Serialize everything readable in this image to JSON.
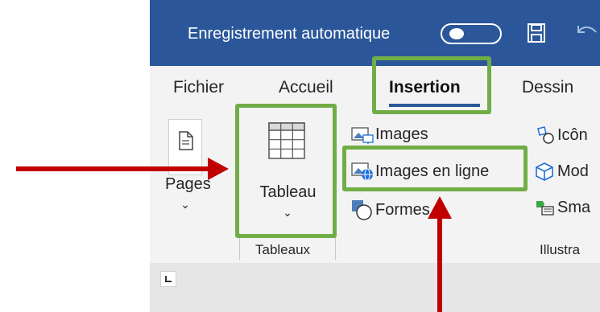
{
  "titlebar": {
    "autosave_label": "Enregistrement automatique",
    "icons": [
      "toggle-switch",
      "save-icon",
      "undo-icon"
    ]
  },
  "tabs": [
    {
      "label": "Fichier"
    },
    {
      "label": "Accueil"
    },
    {
      "label": "Insertion",
      "active": true
    },
    {
      "label": "Dessin"
    }
  ],
  "ribbon": {
    "pages": {
      "label": "Pages",
      "icon": "page-icon"
    },
    "table": {
      "label": "Tableau",
      "icon": "table-grid-icon"
    },
    "commands": [
      {
        "label": "Images",
        "icon": "images-icon"
      },
      {
        "label": "Images en ligne",
        "icon": "online-images-icon"
      },
      {
        "label": "Formes",
        "icon": "shapes-icon"
      }
    ],
    "illustrations_partial": [
      {
        "label": "Icôn",
        "icon": "icons-icon"
      },
      {
        "label": "Mod",
        "icon": "3d-models-icon"
      },
      {
        "label": "Sma",
        "icon": "smartart-icon"
      }
    ],
    "groups": [
      {
        "label": "Tableaux"
      },
      {
        "label": "Illustra"
      }
    ]
  },
  "colors": {
    "title_bar": "#2b579a",
    "ribbon_bg": "#f3f3f3",
    "highlight_box": "#70ad47",
    "arrow": "#c00000"
  }
}
